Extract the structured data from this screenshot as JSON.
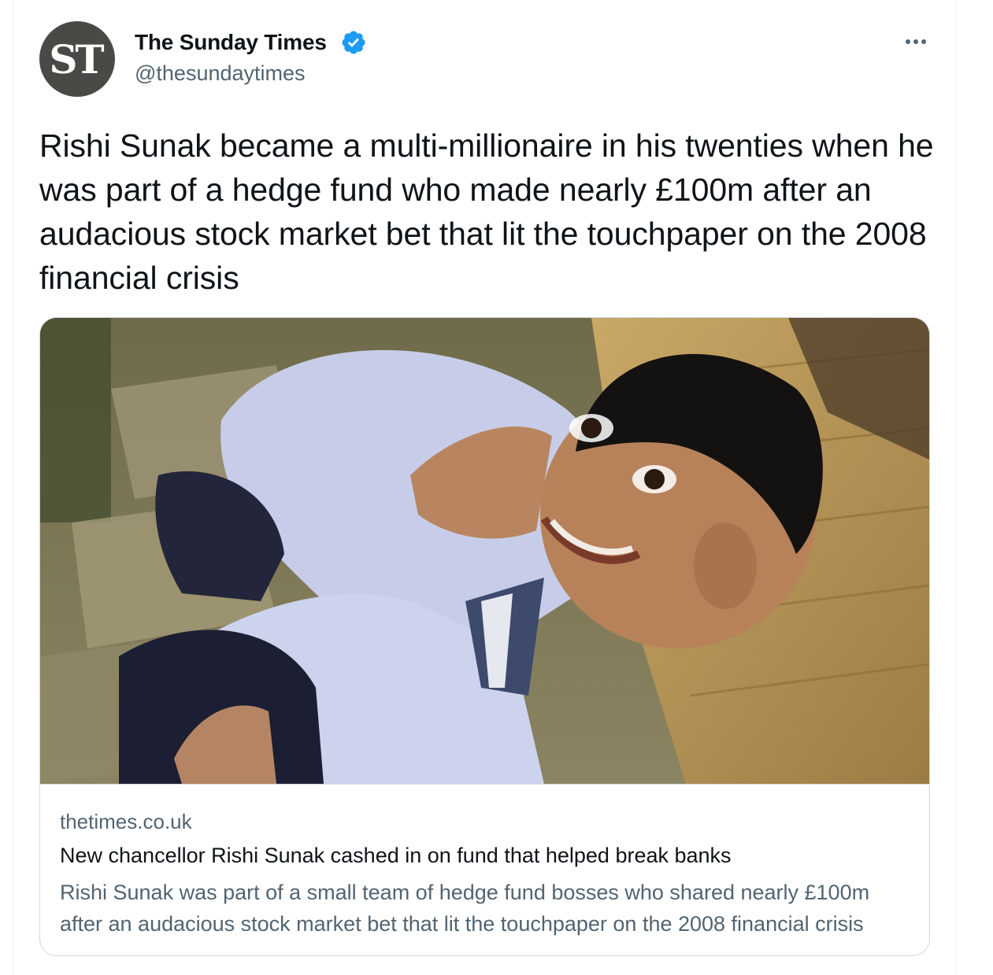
{
  "tweet": {
    "author": {
      "avatar_initials": "ST",
      "name": "The Sunday Times",
      "handle": "@thesundaytimes",
      "verified": true
    },
    "text": "Rishi Sunak became a multi-millionaire in his twenties when he was part of a hedge fund who made nearly £100m after an audacious stock market bet that lit the touchpaper on the 2008 financial crisis",
    "more_icon": "more-horizontal-icon"
  },
  "link_card": {
    "image_subject": "photo-of-smiling-man-in-blue-shirt-against-brick-wall",
    "domain": "thetimes.co.uk",
    "title": "New chancellor Rishi Sunak cashed in on fund that helped break banks",
    "description": "Rishi Sunak was part of a small team of hedge fund bosses who shared nearly £100m after an audacious stock market bet that lit the touchpaper on the 2008 financial crisis"
  },
  "colors": {
    "verified_badge": "#1d9bf0",
    "secondary_text": "#536471",
    "primary_text": "#0f1419",
    "border": "#cfd9de"
  }
}
